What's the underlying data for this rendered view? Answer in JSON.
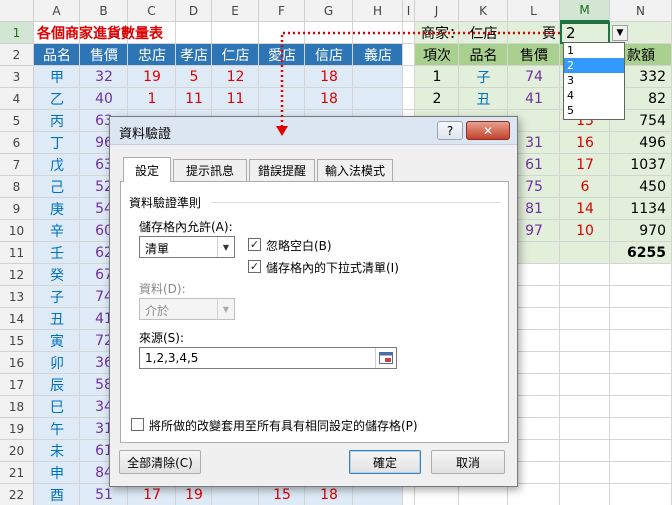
{
  "columns": [
    "A",
    "B",
    "C",
    "D",
    "E",
    "F",
    "G",
    "H",
    "I",
    "J",
    "K",
    "L",
    "M",
    "N"
  ],
  "rows": [
    "1",
    "2",
    "3",
    "4",
    "5",
    "6",
    "7",
    "8",
    "9",
    "10",
    "11",
    "12",
    "13",
    "14",
    "15",
    "16",
    "17",
    "18",
    "19",
    "20",
    "21",
    "22"
  ],
  "sheet": {
    "title": "各個商家進貨數量表",
    "headers_left": [
      "品名",
      "售價",
      "忠店",
      "孝店",
      "仁店",
      "愛店",
      "信店",
      "義店"
    ],
    "left_rows": [
      [
        "甲",
        "32",
        "19",
        "5",
        "12",
        "",
        "18",
        ""
      ],
      [
        "乙",
        "40",
        "1",
        "11",
        "11",
        "",
        "18",
        ""
      ],
      [
        "丙",
        "63",
        "",
        "",
        "",
        "",
        "",
        ""
      ],
      [
        "丁",
        "96",
        "",
        "",
        "",
        "",
        "",
        ""
      ],
      [
        "戊",
        "63",
        "",
        "",
        "",
        "",
        "",
        ""
      ],
      [
        "己",
        "52",
        "",
        "",
        "",
        "",
        "",
        ""
      ],
      [
        "庚",
        "54",
        "",
        "",
        "",
        "",
        "",
        ""
      ],
      [
        "辛",
        "60",
        "",
        "",
        "",
        "",
        "",
        ""
      ],
      [
        "壬",
        "62",
        "",
        "",
        "",
        "",
        "",
        ""
      ],
      [
        "癸",
        "67",
        "",
        "",
        "",
        "",
        "",
        ""
      ],
      [
        "子",
        "74",
        "",
        "",
        "",
        "",
        "",
        ""
      ],
      [
        "丑",
        "41",
        "",
        "",
        "",
        "",
        "",
        ""
      ],
      [
        "寅",
        "72",
        "",
        "",
        "",
        "",
        "",
        ""
      ],
      [
        "卯",
        "36",
        "",
        "",
        "",
        "",
        "",
        ""
      ],
      [
        "辰",
        "58",
        "",
        "",
        "",
        "",
        "",
        ""
      ],
      [
        "巳",
        "34",
        "",
        "",
        "",
        "",
        "",
        ""
      ],
      [
        "午",
        "31",
        "",
        "",
        "",
        "",
        "",
        ""
      ],
      [
        "未",
        "61",
        "",
        "",
        "",
        "",
        "",
        ""
      ],
      [
        "申",
        "84",
        "",
        "",
        "",
        "",
        "",
        ""
      ],
      [
        "酉",
        "51",
        "17",
        "19",
        "",
        "15",
        "18",
        ""
      ]
    ],
    "store_label": "商家：",
    "store_value": "仁店",
    "page_label": "頁",
    "page_value": "2",
    "headers_right": [
      "項次",
      "品名",
      "售價",
      "",
      "款額"
    ],
    "right_rows": [
      [
        "1",
        "子",
        "74",
        "",
        "332"
      ],
      [
        "2",
        "丑",
        "41",
        "",
        "82"
      ],
      [
        "",
        "",
        "",
        "13",
        "754"
      ],
      [
        "",
        "",
        "31",
        "16",
        "496"
      ],
      [
        "",
        "",
        "61",
        "17",
        "1037"
      ],
      [
        "",
        "",
        "75",
        "6",
        "450"
      ],
      [
        "",
        "",
        "81",
        "14",
        "1134"
      ],
      [
        "",
        "",
        "97",
        "10",
        "970"
      ]
    ],
    "total": "6255"
  },
  "dropdown": {
    "options": [
      "1",
      "2",
      "3",
      "4",
      "5"
    ],
    "selected": "2"
  },
  "dialog": {
    "title": "資料驗證",
    "help": "?",
    "close": "✕",
    "tabs": [
      "設定",
      "提示訊息",
      "錯誤提醒",
      "輸入法模式"
    ],
    "group_label": "資料驗證準則",
    "allow_label": "儲存格內允許(A):",
    "allow_value": "清單",
    "ignore_blank": "忽略空白(B)",
    "in_cell_dropdown": "儲存格內的下拉式清單(I)",
    "data_label": "資料(D):",
    "data_value": "介於",
    "source_label": "來源(S):",
    "source_value": "1,2,3,4,5",
    "apply_all": "將所做的改變套用至所有具有相同設定的儲存格(P)",
    "clear_all": "全部清除(C)",
    "ok": "確定",
    "cancel": "取消"
  },
  "colors": {
    "header_blue": "#2e75b6",
    "light_blue": "#deebf7",
    "green_fill": "#e2efda",
    "red": "#e00000",
    "purple": "#7030a0",
    "blue_text": "#0070c0"
  }
}
